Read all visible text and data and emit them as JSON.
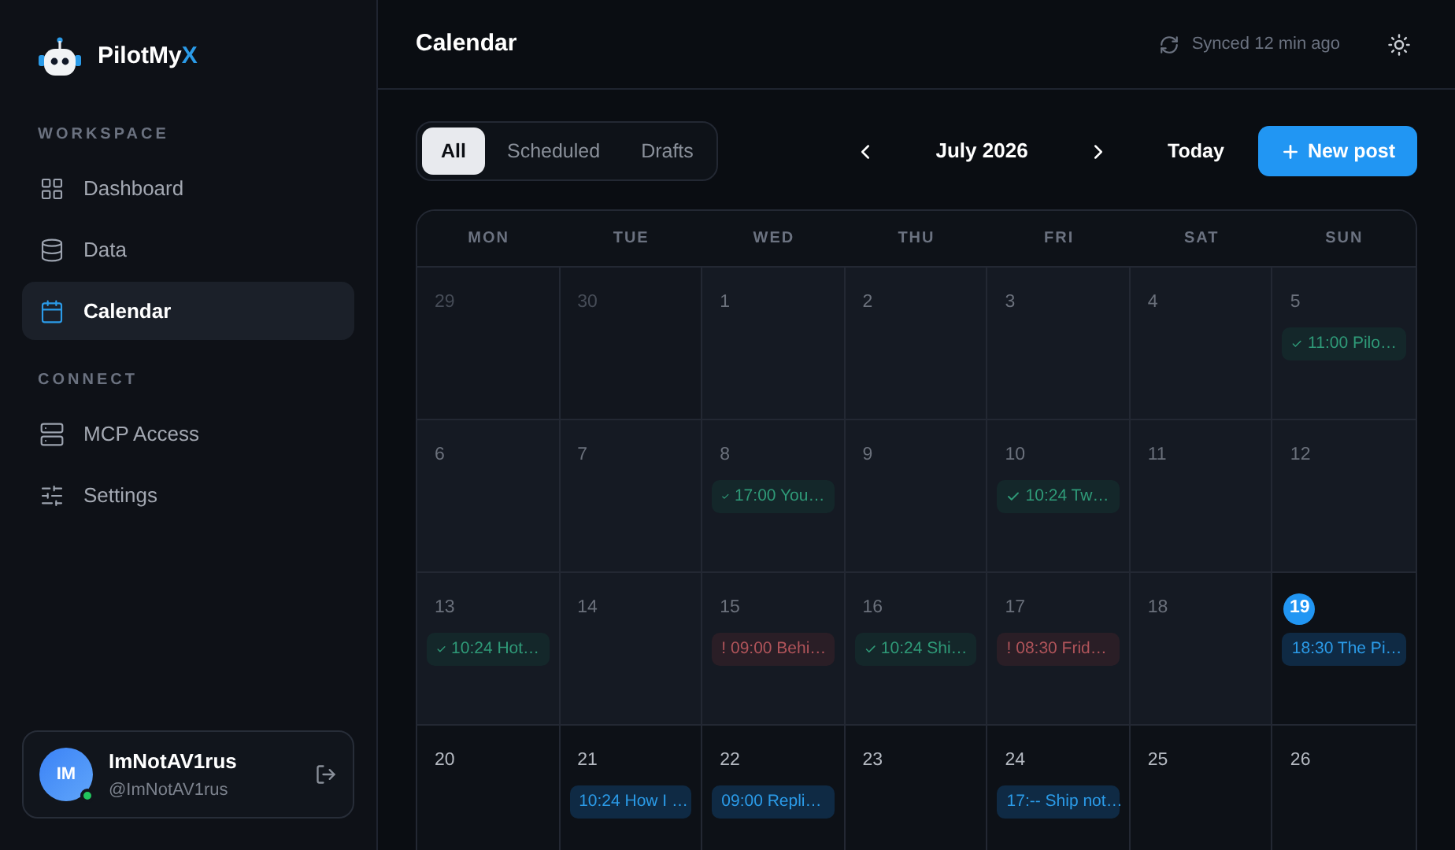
{
  "brand": {
    "name": "PilotMy",
    "accent": "X"
  },
  "sidebar": {
    "sections": [
      {
        "title": "WORKSPACE",
        "items": [
          {
            "label": "Dashboard",
            "selected": false
          },
          {
            "label": "Data",
            "selected": false
          },
          {
            "label": "Calendar",
            "selected": true
          }
        ]
      },
      {
        "title": "CONNECT",
        "items": [
          {
            "label": "MCP Access",
            "selected": false
          },
          {
            "label": "Settings",
            "selected": false
          }
        ]
      }
    ]
  },
  "user": {
    "initials": "IM",
    "name": "ImNotAV1rus",
    "handle": "@ImNotAV1rus",
    "online": true
  },
  "header": {
    "title": "Calendar",
    "sync": "Synced 12 min ago"
  },
  "filters": [
    {
      "label": "All",
      "selected": true
    },
    {
      "label": "Scheduled",
      "selected": false
    },
    {
      "label": "Drafts",
      "selected": false
    }
  ],
  "month": "July 2026",
  "today_button": "Today",
  "new_post": "New post",
  "weekdays": [
    "MON",
    "TUE",
    "WED",
    "THU",
    "FRI",
    "SAT",
    "SUN"
  ],
  "weeks": [
    [
      {
        "day": "29",
        "outside": true,
        "today": false
      },
      {
        "day": "30",
        "outside": true,
        "today": false
      },
      {
        "day": "1",
        "outside": false,
        "past": true,
        "today": false
      },
      {
        "day": "2",
        "outside": false,
        "past": true,
        "today": false
      },
      {
        "day": "3",
        "outside": false,
        "past": true,
        "today": false
      },
      {
        "day": "4",
        "outside": false,
        "past": true,
        "today": false
      },
      {
        "day": "5",
        "outside": false,
        "past": true,
        "today": false,
        "events": [
          {
            "kind": "published",
            "text": "11:00 Pilo…"
          }
        ]
      }
    ],
    [
      {
        "day": "6",
        "outside": false,
        "past": true,
        "today": false
      },
      {
        "day": "7",
        "outside": false,
        "past": true,
        "today": false
      },
      {
        "day": "8",
        "outside": false,
        "past": true,
        "today": false,
        "events": [
          {
            "kind": "published",
            "text": "17:00 You…"
          }
        ]
      },
      {
        "day": "9",
        "outside": false,
        "past": true,
        "today": false
      },
      {
        "day": "10",
        "outside": false,
        "past": true,
        "today": false,
        "events": [
          {
            "kind": "published",
            "text": "10:24 Tw…"
          }
        ]
      },
      {
        "day": "11",
        "outside": false,
        "past": true,
        "today": false
      },
      {
        "day": "12",
        "outside": false,
        "past": true,
        "today": false
      }
    ],
    [
      {
        "day": "13",
        "outside": false,
        "past": true,
        "today": false,
        "events": [
          {
            "kind": "published",
            "text": "10:24 Hot…"
          }
        ]
      },
      {
        "day": "14",
        "outside": false,
        "past": true,
        "today": false
      },
      {
        "day": "15",
        "outside": false,
        "past": true,
        "today": false,
        "events": [
          {
            "kind": "failed",
            "text": "! 09:00 Behi…"
          }
        ]
      },
      {
        "day": "16",
        "outside": false,
        "past": true,
        "today": false,
        "events": [
          {
            "kind": "published",
            "text": "10:24 Shi…"
          }
        ]
      },
      {
        "day": "17",
        "outside": false,
        "past": true,
        "today": false,
        "events": [
          {
            "kind": "failed",
            "text": "! 08:30 Frid…"
          }
        ]
      },
      {
        "day": "18",
        "outside": false,
        "past": true,
        "today": false
      },
      {
        "day": "19",
        "outside": false,
        "past": false,
        "today": true,
        "events": [
          {
            "kind": "scheduled",
            "text": "18:30 The Pi…"
          }
        ]
      }
    ],
    [
      {
        "day": "20",
        "outside": false,
        "past": false,
        "today": false
      },
      {
        "day": "21",
        "outside": false,
        "past": false,
        "today": false,
        "events": [
          {
            "kind": "scheduled",
            "text": "10:24 How I …"
          }
        ]
      },
      {
        "day": "22",
        "outside": false,
        "past": false,
        "today": false,
        "events": [
          {
            "kind": "scheduled",
            "text": "09:00 Repli…"
          }
        ]
      },
      {
        "day": "23",
        "outside": false,
        "past": false,
        "today": false
      },
      {
        "day": "24",
        "outside": false,
        "past": false,
        "today": false,
        "events": [
          {
            "kind": "scheduled",
            "text": "17:-- Ship not…"
          }
        ]
      },
      {
        "day": "25",
        "outside": false,
        "past": false,
        "today": false
      },
      {
        "day": "26",
        "outside": false,
        "past": false,
        "today": false
      }
    ]
  ]
}
